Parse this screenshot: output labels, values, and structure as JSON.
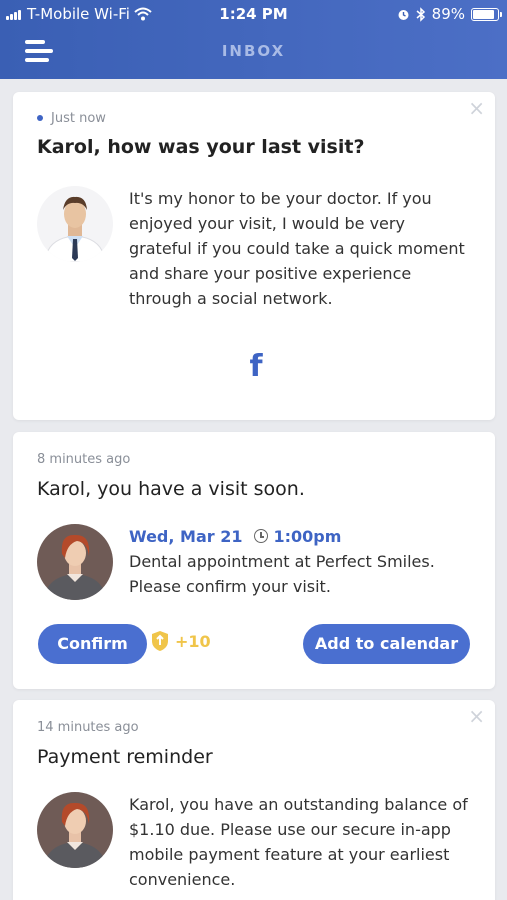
{
  "status_bar": {
    "carrier": "T-Mobile Wi-Fi",
    "time": "1:24 PM",
    "battery": "89%"
  },
  "header": {
    "title": "INBOX"
  },
  "notifications": [
    {
      "time": "Just now",
      "title": "Karol, how was your last visit?",
      "message": "It's my honor to be your doctor. If you enjoyed your visit, I would be very grateful if you could take a quick moment and share your positive experience through a social network.",
      "share_icon": "facebook-icon",
      "share_glyph": "f"
    },
    {
      "time": "8 minutes ago",
      "title": "Karol, you have a visit soon.",
      "date": "Wed, Mar 21",
      "appt_time": "1:00pm",
      "message": "Dental appointment at Perfect Smiles. Please confirm your visit.",
      "confirm_label": "Confirm",
      "points": "+10",
      "calendar_label": "Add to calendar"
    },
    {
      "time": "14 minutes ago",
      "title": "Payment reminder",
      "message": "Karol,  you have an outstanding balance of $1.10 due. Please use our secure in-app mobile payment feature at your earliest convenience."
    }
  ],
  "colors": {
    "header": "#3a5fb4",
    "accent": "#4a6fd0",
    "gold": "#f0c54a",
    "facebook": "#3e64c4"
  }
}
